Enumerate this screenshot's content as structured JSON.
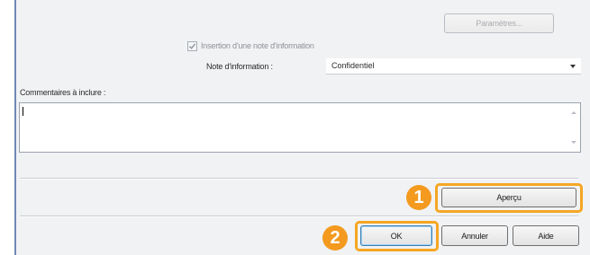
{
  "dialog": {
    "parametres_label": "Paramètres...",
    "insertion_checkbox_label": "Insertion d'une note d'information",
    "insertion_checked": true,
    "note_label": "Note d'information :",
    "note_value": "Confidentiel",
    "comments_label": "Commentaires à inclure :",
    "comments_value": "",
    "apercu_label": "Aperçu",
    "ok_label": "OK",
    "annuler_label": "Annuler",
    "aide_label": "Aide"
  },
  "callouts": {
    "badge1": "1",
    "badge2": "2",
    "color": "#f39a1f"
  },
  "colors": {
    "highlight": "#f5a623",
    "dialog_bg": "#f1f2f4",
    "window_border": "#6f88b4"
  }
}
